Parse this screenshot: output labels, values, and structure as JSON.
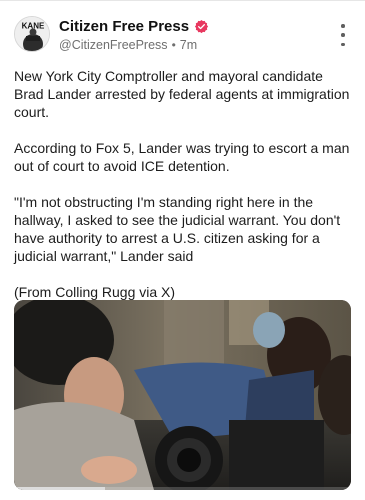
{
  "post": {
    "author": {
      "display_name": "Citizen Free Press",
      "handle": "@CitizenFreePress",
      "timestamp": "7m",
      "avatar_text": "KANE",
      "verified": true
    },
    "paragraphs": [
      "New York City Comptroller and mayoral candidate Brad Lander arrested by federal agents at immigration court.",
      "According to Fox 5, Lander was trying to escort a man out of court to avoid ICE detention.",
      "\"I'm not obstructing I'm standing right here in the hallway, I asked to see the judicial warrant. You don't have authority to arrest a U.S. citizen asking for a judicial warrant,\" Lander said",
      "(From Colling Rugg via X)"
    ],
    "media": {
      "type": "video",
      "progress_percent": 27
    }
  },
  "icons": {
    "verified": "verified-badge-icon",
    "more": "more-vertical-icon"
  },
  "colors": {
    "verified_badge": "#e8385f",
    "text": "#1c1c1c",
    "meta_text": "#6f6f6f",
    "background": "#ffffff"
  }
}
